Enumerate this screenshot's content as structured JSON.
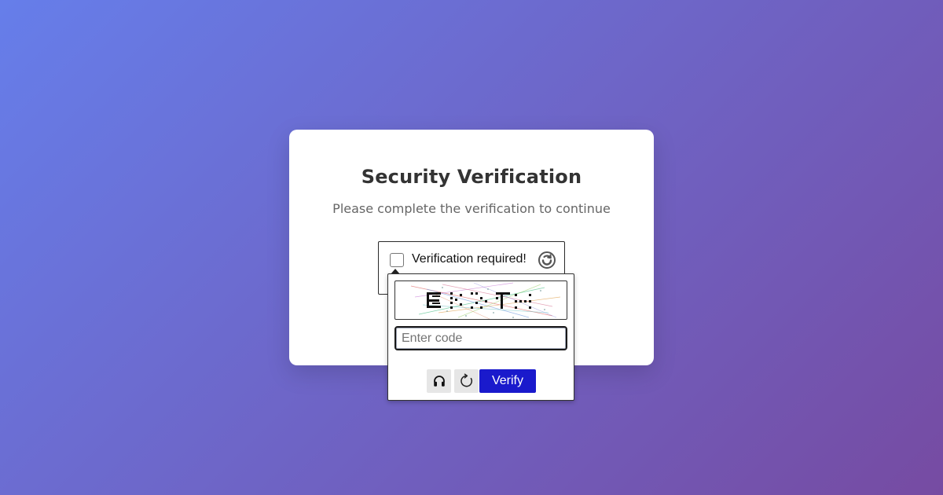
{
  "card": {
    "title": "Security Verification",
    "subtitle": "Please complete the verification to continue"
  },
  "widget": {
    "label": "Verification required!",
    "logo_icon": "refresh-circle-icon"
  },
  "popup": {
    "captcha_image": "distorted-captcha-image",
    "input": {
      "placeholder": "Enter code",
      "value": ""
    },
    "audio_icon": "headphones-icon",
    "refresh_icon": "refresh-icon",
    "verify_label": "Verify"
  },
  "colors": {
    "background_start": "#667eea",
    "background_end": "#764ba2",
    "card": "#ffffff",
    "title": "#333333",
    "subtitle": "#666666",
    "verify_button": "#1a1acc"
  }
}
